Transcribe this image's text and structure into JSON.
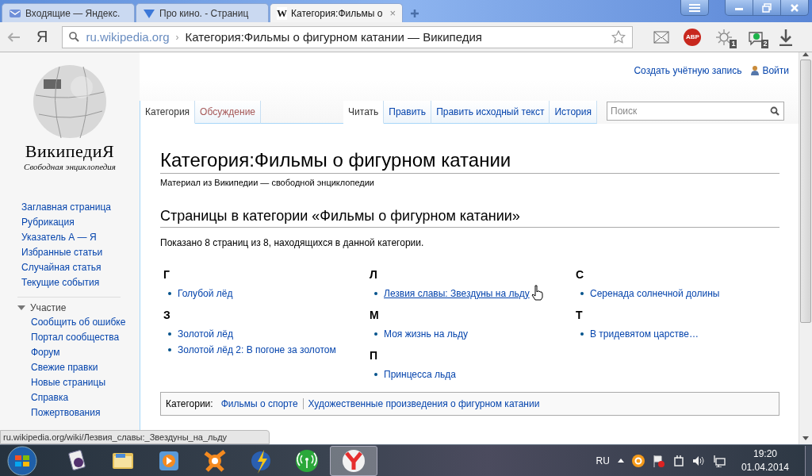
{
  "browser": {
    "tabs": [
      {
        "title": "Входящие — Яндекс.",
        "kind": "mail",
        "selected": false
      },
      {
        "title": "Про кино. - Страниц",
        "kind": "check",
        "selected": false
      },
      {
        "title": "Категория:Фильмы о",
        "kind": "wiki",
        "icon_text": "W",
        "selected": true,
        "close": "×"
      }
    ],
    "address": {
      "domain": "ru.wikipedia.org",
      "separator": "›",
      "path": "Категория:Фильмы о фигурном катании — Википедия"
    },
    "yandex_button": "Я",
    "extensions": [
      {
        "kind": "mail"
      },
      {
        "kind": "abp",
        "text": "ABP"
      },
      {
        "kind": "sun",
        "badge": "1"
      },
      {
        "kind": "cloud",
        "badge": "2"
      },
      {
        "kind": "download"
      }
    ]
  },
  "page": {
    "personal": [
      "Создать учётную запись",
      "Войти"
    ],
    "logo": {
      "wordmark": "ВикипедиЯ",
      "tagline": "Свободная энциклопедия"
    },
    "nav": [
      "Заглавная страница",
      "Рубрикация",
      "Указатель А — Я",
      "Избранные статьи",
      "Случайная статья",
      "Текущие события"
    ],
    "section": {
      "title": "Участие",
      "expanded": true,
      "items": [
        "Сообщить об ошибке",
        "Портал сообщества",
        "Форум",
        "Свежие правки",
        "Новые страницы",
        "Справка",
        "Пожертвования"
      ]
    },
    "tabs_left": [
      {
        "label": "Категория",
        "selected": true,
        "red_link": false
      },
      {
        "label": "Обсуждение",
        "selected": false,
        "red_link": true
      }
    ],
    "tabs_right": [
      {
        "label": "Читать",
        "selected": true
      },
      {
        "label": "Править",
        "selected": false
      },
      {
        "label": "Править исходный текст",
        "selected": false
      },
      {
        "label": "История",
        "selected": false
      }
    ],
    "search": {
      "placeholder": "Поиск"
    },
    "title": "Категория:Фильмы о фигурном катании",
    "subtitle": "Материал из Википедии — свободной энциклопедии",
    "section_heading": "Страницы в категории «Фильмы о фигурном катании»",
    "count_text": "Показано 8 страниц из 8, находящихся в данной категории.",
    "columns": [
      [
        {
          "letter": "Г",
          "items": [
            {
              "title": "Голубой лёд",
              "hovered": false
            }
          ]
        },
        {
          "letter": "З",
          "items": [
            {
              "title": "Золотой лёд",
              "hovered": false
            },
            {
              "title": "Золотой лёд 2: В погоне за золотом",
              "hovered": false
            }
          ]
        }
      ],
      [
        {
          "letter": "Л",
          "items": [
            {
              "title": "Лезвия славы: Звездуны на льду",
              "hovered": true
            }
          ]
        },
        {
          "letter": "М",
          "items": [
            {
              "title": "Моя жизнь на льду",
              "hovered": false
            }
          ]
        },
        {
          "letter": "П",
          "items": [
            {
              "title": "Принцесса льда",
              "hovered": false
            }
          ]
        }
      ],
      [
        {
          "letter": "С",
          "items": [
            {
              "title": "Серенада солнечной долины",
              "hovered": false
            }
          ]
        },
        {
          "letter": "Т",
          "items": [
            {
              "title": "В тридевятом царстве…",
              "hovered": false
            }
          ]
        }
      ]
    ],
    "categories": {
      "label": "Категории:",
      "items": [
        "Фильмы о спорте",
        "Художественные произведения о фигурном катании"
      ]
    },
    "status_url": "ru.wikipedia.org/wiki/Лезвия_славы:_Звездуны_на_льду"
  },
  "taskbar": {
    "apps": [
      {
        "kind": "cards",
        "selected": false
      },
      {
        "kind": "folder",
        "selected": false
      },
      {
        "kind": "player",
        "selected": false
      },
      {
        "kind": "avast",
        "selected": false
      },
      {
        "kind": "bolt",
        "selected": false
      },
      {
        "kind": "radio",
        "selected": false
      },
      {
        "kind": "yandex",
        "selected": true
      }
    ],
    "language": "RU",
    "time": "19:20",
    "date": "01.04.2014"
  }
}
